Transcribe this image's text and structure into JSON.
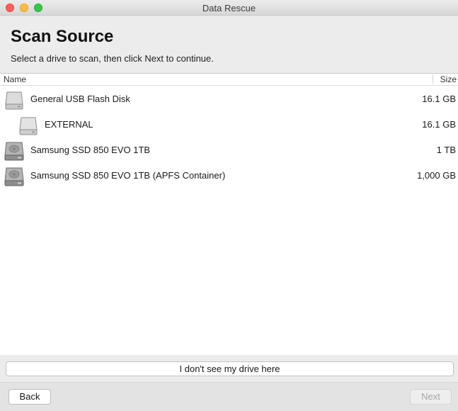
{
  "window": {
    "title": "Data Rescue"
  },
  "header": {
    "title": "Scan Source",
    "subtitle": "Select a drive to scan, then click Next to continue."
  },
  "table": {
    "columns": {
      "name": "Name",
      "size": "Size"
    },
    "rows": [
      {
        "name": "General USB Flash Disk",
        "size": "16.1 GB",
        "icon": "usb-drive-icon"
      },
      {
        "name": "EXTERNAL",
        "size": "16.1 GB",
        "icon": "volume-icon"
      },
      {
        "name": "Samsung SSD 850 EVO 1TB",
        "size": "1 TB",
        "icon": "internal-disk-icon"
      },
      {
        "name": "Samsung SSD 850 EVO 1TB (APFS Container)",
        "size": "1,000 GB",
        "icon": "internal-disk-icon"
      }
    ]
  },
  "actions": {
    "no_drive": "I don't see my drive here",
    "back": "Back",
    "next": "Next"
  }
}
